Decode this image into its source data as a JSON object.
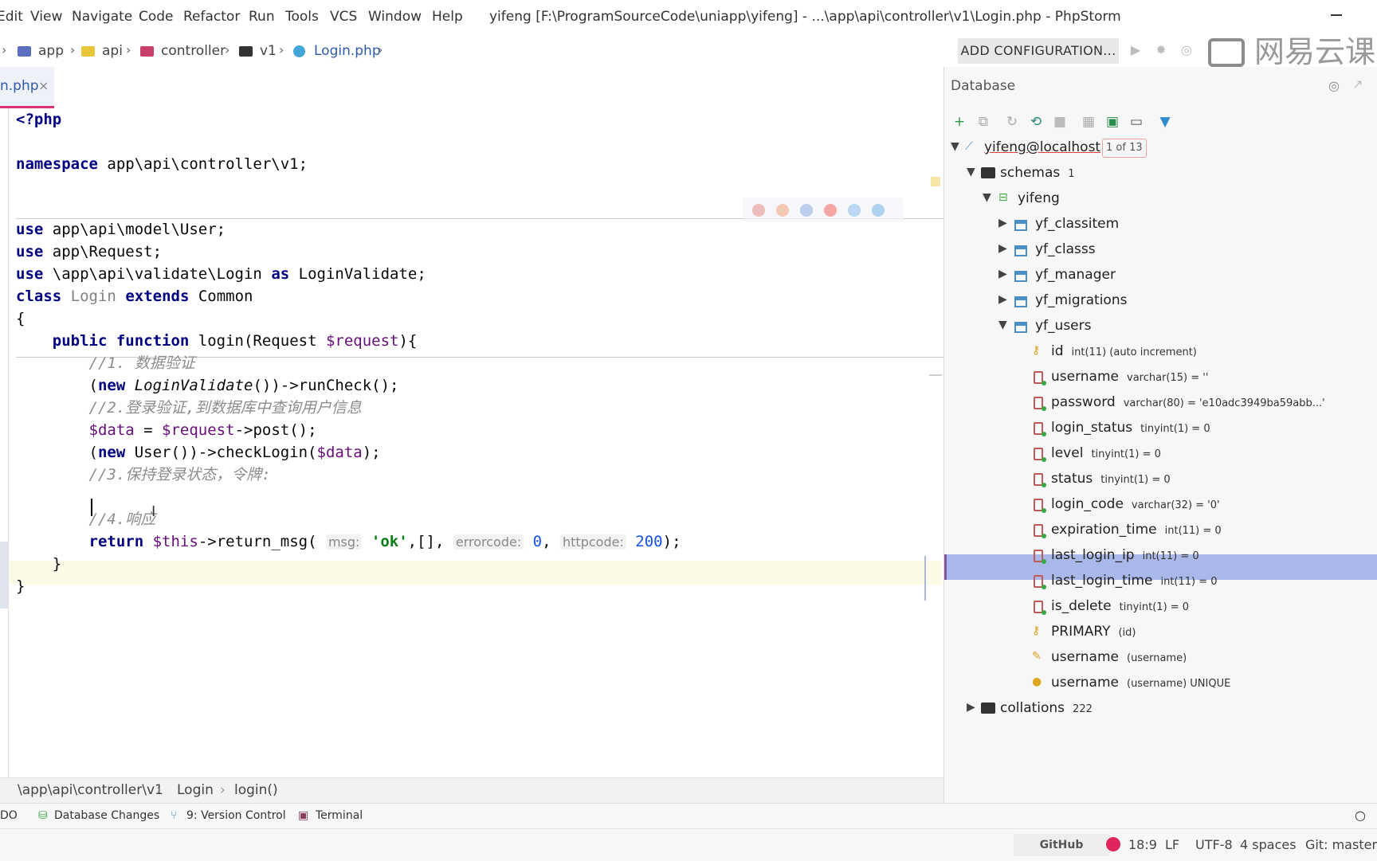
{
  "menu": [
    "Edit",
    "View",
    "Navigate",
    "Code",
    "Refactor",
    "Run",
    "Tools",
    "VCS",
    "Window",
    "Help"
  ],
  "window_title": "yifeng [F:\\ProgramSourceCode\\uniapp\\yifeng] - ...\\app\\api\\controller\\v1\\Login.php - PhpStorm",
  "breadcrumbs": [
    "app",
    "api",
    "controller",
    "v1",
    "Login.php"
  ],
  "toolbar": {
    "add_configuration": "ADD CONFIGURATION..."
  },
  "watermark": "网易云课",
  "editor": {
    "tab_label": "n.php",
    "tab_close": "×",
    "code_lines": [
      "<?php",
      "",
      "namespace app\\api\\controller\\v1;",
      "",
      "",
      "use app\\api\\model\\User;",
      "use app\\Request;",
      "use \\app\\api\\validate\\Login as LoginValidate;",
      "class Login extends Common",
      "{",
      "    public function login(Request $request){",
      "        //1. 数据验证",
      "        (new LoginValidate())->runCheck();",
      "        //2.登录验证,到数据库中查询用户信息",
      "        $data = $request->post();",
      "        (new User())->checkLogin($data);",
      "        //3.保持登录状态，令牌:",
      "        ",
      "        //4.响应",
      "        return $this->return_msg( msg: 'ok',[], errorcode: 0, httpcode: 200);",
      "    }",
      "}"
    ],
    "hints": {
      "msg": "msg:",
      "errorcode": "errorcode:",
      "httpcode": "httpcode:"
    },
    "breadcrumb": [
      "\\app\\api\\controller\\v1",
      "Login",
      "login()"
    ]
  },
  "tool_windows": [
    "DO",
    "Database Changes",
    "9: Version Control",
    "Terminal"
  ],
  "status": {
    "github": "GitHub",
    "position": "18:9",
    "line_separator": "LF",
    "encoding": "UTF-8",
    "indent": "4 spaces",
    "vcs": "Git: master"
  },
  "database": {
    "title": "Database",
    "connection": "yifeng@localhost",
    "pager": "1 of 13",
    "schemas_label": "schemas",
    "schemas_count": "1",
    "schema": "yifeng",
    "tables": [
      "yf_classitem",
      "yf_classs",
      "yf_manager",
      "yf_migrations",
      "yf_users"
    ],
    "columns": [
      {
        "name": "id",
        "type": "int(11) (auto increment)"
      },
      {
        "name": "username",
        "type": "varchar(15) = ''"
      },
      {
        "name": "password",
        "type": "varchar(80) = 'e10adc3949ba59abb...'"
      },
      {
        "name": "login_status",
        "type": "tinyint(1) = 0"
      },
      {
        "name": "level",
        "type": "tinyint(1) = 0"
      },
      {
        "name": "status",
        "type": "tinyint(1) = 0"
      },
      {
        "name": "login_code",
        "type": "varchar(32) = '0'"
      },
      {
        "name": "expiration_time",
        "type": "int(11) = 0"
      },
      {
        "name": "last_login_ip",
        "type": "int(11) = 0"
      },
      {
        "name": "last_login_time",
        "type": "int(11) = 0"
      },
      {
        "name": "is_delete",
        "type": "tinyint(1) = 0"
      }
    ],
    "keys": [
      {
        "name": "PRIMARY",
        "detail": "(id)"
      },
      {
        "name": "username",
        "detail": "(username)"
      },
      {
        "name": "username",
        "detail": "(username) UNIQUE"
      }
    ],
    "collations_label": "collations",
    "collations_count": "222"
  },
  "colors": {
    "accent": "#d8326f",
    "selection": "#a9b8e8",
    "keyword": "#000080",
    "string": "#067d17"
  }
}
